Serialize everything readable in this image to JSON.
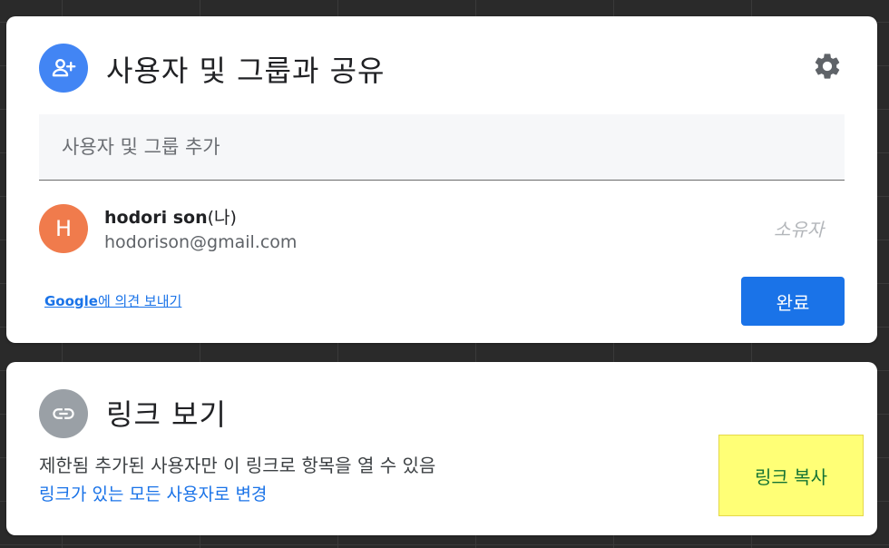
{
  "share": {
    "title": "사용자 및 그룹과 공유",
    "add_placeholder": "사용자 및 그룹 추가",
    "user": {
      "avatar_letter": "H",
      "name": "hodori son",
      "name_suffix": "(나)",
      "email": "hodorison@gmail.com",
      "role": "소유자"
    },
    "feedback_brand": "Google",
    "feedback_text": "에 의견 보내기",
    "done_label": "완료"
  },
  "link": {
    "title": "링크 보기",
    "description": "제한됨 추가된 사용자만 이 링크로 항목을 열 수 있음",
    "change_label": "링크가 있는 모든 사용자로 변경",
    "copy_label": "링크 복사"
  },
  "icons": {
    "add_person": "add-person-icon",
    "settings": "gear-icon",
    "link": "link-icon"
  },
  "colors": {
    "accent": "#1a73e8",
    "add_person_bg": "#4285f4",
    "link_icon_bg": "#9aa0a6",
    "avatar_bg": "#f07b4c",
    "copy_highlight": "#ffff76"
  }
}
